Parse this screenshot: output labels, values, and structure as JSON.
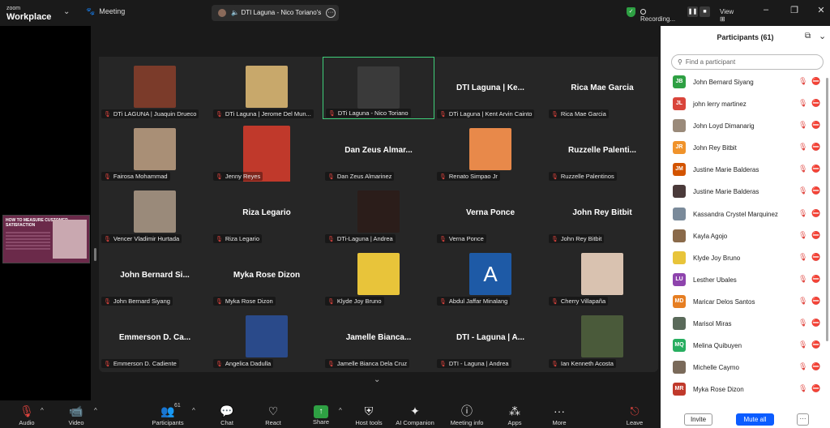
{
  "app": {
    "brand_small": "zoom",
    "brand_large": "Workplace",
    "meeting_label": "Meeting"
  },
  "active_speaker": {
    "name": "DTI Laguna - Nico Toriano's"
  },
  "recording": {
    "label": "Recording..."
  },
  "view_label": "View",
  "window_controls": [
    "–",
    "❐",
    "✕"
  ],
  "colors": {
    "active_border": "#3fd07a",
    "muted_red": "#e0443e",
    "primary_blue": "#0b5cff",
    "share_green": "#2ea043"
  },
  "gallery": [
    {
      "label": "DTi LAGUNA | Juaquin Drueco",
      "photo": "#7b3b2a"
    },
    {
      "label": "DTi Laguna | Jerome Del Mun...",
      "photo": "#c8a86b"
    },
    {
      "label": "DTi Laguna - Nico Toriano",
      "photo": "#3a3a3a",
      "active": true
    },
    {
      "label": "DTi Laguna | Kent Arvin Cainto",
      "big": "DTI Laguna | Ke..."
    },
    {
      "label": "Rica Mae Garcia",
      "big": "Rica Mae Garcia"
    },
    {
      "label": "Fairosa Mohammad",
      "photo": "#a98f76"
    },
    {
      "label": "Jenny Reyes",
      "photo": "#c0392b",
      "tall": true
    },
    {
      "label": "Dan Zeus Almarinez",
      "big": "Dan Zeus Almar..."
    },
    {
      "label": "Renato Simpao Jr",
      "photo": "#e8894a"
    },
    {
      "label": "Ruzzelle Palentinos",
      "big": "Ruzzelle  Palenti..."
    },
    {
      "label": "Vencer Vladimir Hurtada",
      "photo": "#9a8a7a"
    },
    {
      "label": "Riza Legario",
      "big": "Riza Legario"
    },
    {
      "label": "DTi-Laguna | Andrea",
      "photo": "#2b1d1a"
    },
    {
      "label": "Verna Ponce",
      "big": "Verna Ponce"
    },
    {
      "label": "John Rey Bitbit",
      "big": "John Rey Bitbit"
    },
    {
      "label": "John Bernard Siyang",
      "big": "John  Bernard Si..."
    },
    {
      "label": "Myka Rose Dizon",
      "big": "Myka Rose Dizon"
    },
    {
      "label": "Klyde Joy Bruno",
      "photo": "#e8c43a"
    },
    {
      "label": "Abdul Jaffar Minalang",
      "avatar_letter": "A"
    },
    {
      "label": "Cherry Villapaña",
      "photo": "#d9c2b0"
    },
    {
      "label": "Emmerson D. Cadiente",
      "big": "Emmerson D. Ca..."
    },
    {
      "label": "Angelica Dadulla",
      "photo": "#2a4a8a"
    },
    {
      "label": "Jamelle Bianca Dela Cruz",
      "big": "Jamelle  Bianca..."
    },
    {
      "label": "DTI - Laguna | Andrea",
      "big": "DTI - Laguna | A..."
    },
    {
      "label": "Ian Kenneth Acosta",
      "photo": "#4a5a3a"
    }
  ],
  "shared_thumb": {
    "title": "HOW TO MEASURE CUSTOMER SATISFACTION"
  },
  "participants_panel": {
    "title": "Participants (61)",
    "search_placeholder": "Find a participant",
    "people": [
      {
        "initials": "JB",
        "name": "John Bernard Siyang",
        "color": "#2ea043"
      },
      {
        "initials": "JL",
        "name": "john lerry martinez",
        "color": "#d9453b"
      },
      {
        "initials": "",
        "name": "John Loyd Dimanarig",
        "color": "#9a8a7a"
      },
      {
        "initials": "JR",
        "name": "John Rey Bitbit",
        "color": "#f0932b"
      },
      {
        "initials": "JM",
        "name": "Justine Marie Balderas",
        "color": "#d35400"
      },
      {
        "initials": "",
        "name": "Justine Marie Balderas",
        "color": "#4a3a3a"
      },
      {
        "initials": "",
        "name": "Kassandra Crystel Marquinez",
        "color": "#7a8a9a"
      },
      {
        "initials": "",
        "name": "Kayla Agojo",
        "color": "#8a6a4a"
      },
      {
        "initials": "",
        "name": "Klyde Joy Bruno",
        "color": "#e8c43a"
      },
      {
        "initials": "LU",
        "name": "Lesther Ubales",
        "color": "#8e44ad"
      },
      {
        "initials": "MD",
        "name": "Maricar Delos Santos",
        "color": "#e67e22"
      },
      {
        "initials": "",
        "name": "Marisol Miras",
        "color": "#5a6a5a"
      },
      {
        "initials": "MQ",
        "name": "Melina Quibuyen",
        "color": "#27ae60"
      },
      {
        "initials": "",
        "name": "Michelle Caymo",
        "color": "#7a6a5a"
      },
      {
        "initials": "MR",
        "name": "Myka Rose Dizon",
        "color": "#c0392b"
      }
    ],
    "invite_label": "Invite",
    "mute_all_label": "Mute all",
    "more_label": "···"
  },
  "toolbar": [
    {
      "label": "Audio",
      "icon": "🎙",
      "red": true,
      "name": "audio"
    },
    {
      "label": "Video",
      "icon": "📹",
      "red": true,
      "name": "video"
    },
    {
      "label": "Participants",
      "icon": "👥",
      "name": "participants",
      "badge": "61"
    },
    {
      "label": "Chat",
      "icon": "💬",
      "name": "chat"
    },
    {
      "label": "React",
      "icon": "♡",
      "name": "react"
    },
    {
      "label": "Share",
      "icon": "↑",
      "green": true,
      "name": "share"
    },
    {
      "label": "Host tools",
      "icon": "⛨",
      "name": "host-tools"
    },
    {
      "label": "AI Companion",
      "icon": "✦",
      "name": "ai-companion"
    },
    {
      "label": "Meeting info",
      "icon": "ⓘ",
      "name": "meeting-info"
    },
    {
      "label": "Apps",
      "icon": "⁂",
      "name": "apps"
    },
    {
      "label": "More",
      "icon": "···",
      "name": "more"
    },
    {
      "label": "Leave",
      "icon": "⎋",
      "red": true,
      "name": "leave"
    }
  ]
}
